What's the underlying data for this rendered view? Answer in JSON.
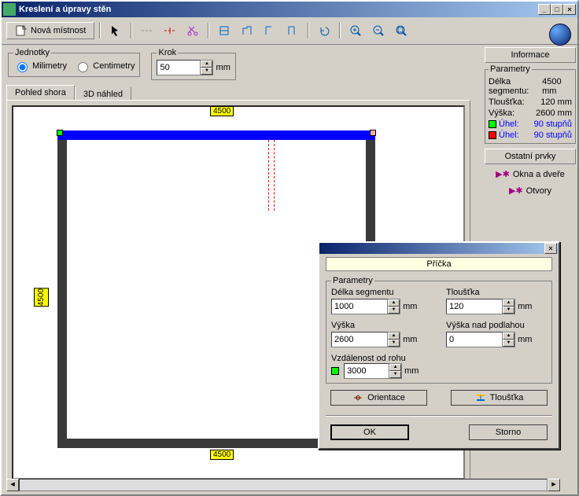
{
  "window": {
    "title": "Kreslení a úpravy stěn"
  },
  "toolbar": {
    "new_room": "Nová místnost"
  },
  "units": {
    "legend": "Jednotky",
    "mm_label": "Milimetry",
    "cm_label": "Centimetry"
  },
  "step": {
    "legend": "Krok",
    "value": "50",
    "unit": "mm"
  },
  "tabs": {
    "top_view": "Pohled shora",
    "preview3d": "3D náhled"
  },
  "dims": {
    "top": "4500",
    "left": "4500",
    "bottom": "4500"
  },
  "info": {
    "title": "Informace",
    "params_legend": "Parametry",
    "length_label": "Délka segmentu:",
    "length_value": "4500 mm",
    "thickness_label": "Tloušťka:",
    "thickness_value": "120 mm",
    "height_label": "Výška:",
    "height_value": "2600 mm",
    "angle_label": "Úhel:",
    "angle_value": "90 stupňů",
    "other_title": "Ostatní prvky",
    "windows_doors": "Okna a dveře",
    "openings": "Otvory"
  },
  "dialog": {
    "title": "Příčka",
    "params_legend": "Parametry",
    "length_label": "Délka segmentu",
    "length_value": "1000",
    "thickness_label": "Tloušťka",
    "thickness_value": "120",
    "height_label": "Výška",
    "height_value": "2600",
    "floor_height_label": "Výška nad podlahou",
    "floor_height_value": "0",
    "corner_dist_label": "Vzdálenost od rohu",
    "corner_dist_value": "3000",
    "unit": "mm",
    "orientation_btn": "Orientace",
    "thickness_btn": "Tloušťka",
    "ok_btn": "OK",
    "cancel_btn": "Storno"
  }
}
